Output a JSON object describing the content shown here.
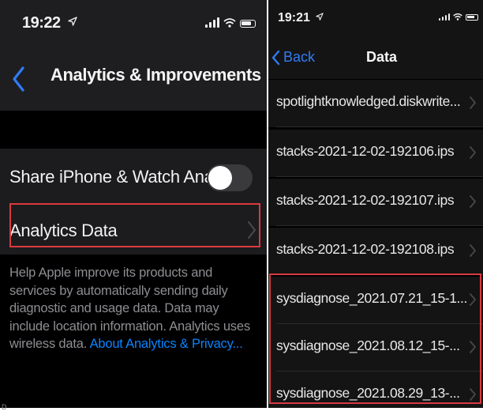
{
  "left_screen": {
    "status_time": "19:22",
    "nav_title": "Analytics & Improvements",
    "rows": {
      "share_label": "Share iPhone & Watch Ana...",
      "analytics_data_label": "Analytics Data"
    },
    "footer": {
      "text": "Help Apple improve its products and services by automatically sending daily diagnostic and usage data. Data may include location information. Analytics uses wireless data. ",
      "link": "About Analytics & Privacy..."
    },
    "toggle_state": "off"
  },
  "right_screen": {
    "status_time": "19:21",
    "back_label": "Back",
    "nav_title": "Data",
    "files": [
      "spotlightknowledged.diskwrite...",
      "stacks-2021-12-02-192106.ips",
      "stacks-2021-12-02-192107.ips",
      "stacks-2021-12-02-192108.ips",
      "sysdiagnose_2021.07.21_15-1...",
      "sysdiagnose_2021.08.12_15-...",
      "sysdiagnose_2021.08.29_13-..."
    ]
  },
  "colors": {
    "accent": "#0a84ff",
    "highlight": "#d93a3f",
    "cell_background": "#1c1c1e",
    "secondary_text": "#8e8e93"
  },
  "icons": [
    "location-arrow-icon",
    "cellular-signal-icon",
    "wifi-icon",
    "battery-icon",
    "back-chevron-icon",
    "chevron-right-icon"
  ]
}
